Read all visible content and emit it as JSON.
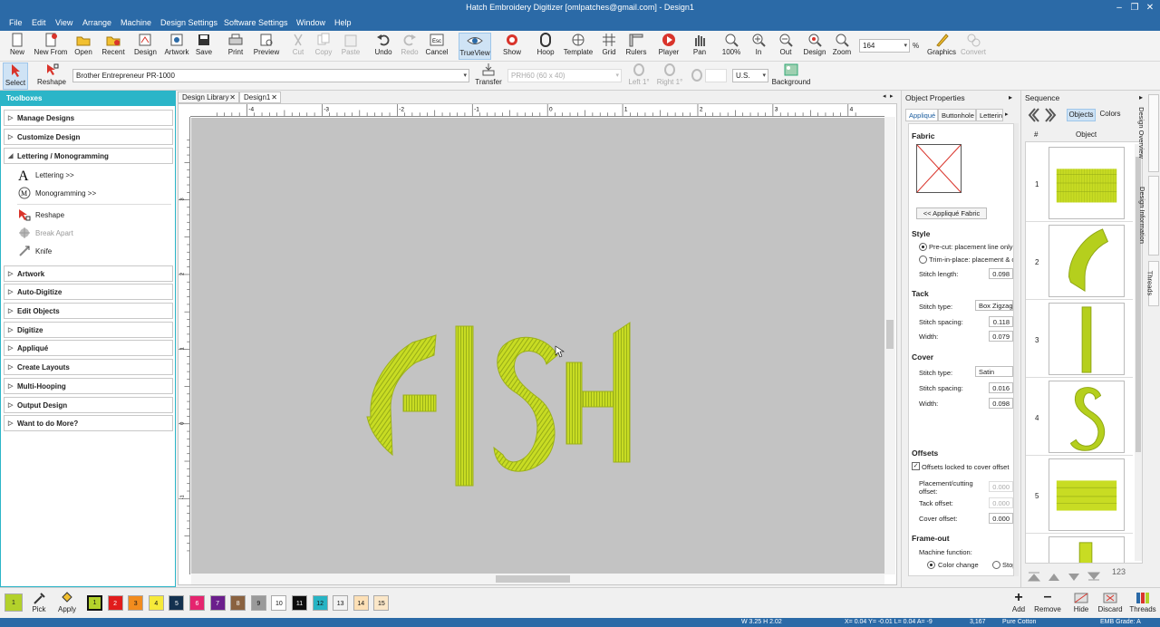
{
  "window": {
    "title": "Hatch Embroidery Digitizer [omlpatches@gmail.com] - Design1"
  },
  "menu": [
    "File",
    "Edit",
    "View",
    "Arrange",
    "Machine",
    "Design Settings",
    "Software Settings",
    "Window",
    "Help"
  ],
  "toolbar": {
    "items": [
      {
        "label": "New",
        "icon": "new-icon"
      },
      {
        "label": "New From",
        "icon": "new-from-icon"
      },
      {
        "label": "Open",
        "icon": "open-icon"
      },
      {
        "label": "Recent",
        "icon": "recent-icon"
      },
      {
        "label": "Design",
        "icon": "design-icon"
      },
      {
        "label": "Artwork",
        "icon": "artwork-icon"
      },
      {
        "label": "Save",
        "icon": "save-icon"
      },
      {
        "label": "Print",
        "icon": "print-icon"
      },
      {
        "label": "Preview",
        "icon": "preview-icon"
      },
      {
        "label": "Cut",
        "icon": "cut-icon"
      },
      {
        "label": "Copy",
        "icon": "copy-icon"
      },
      {
        "label": "Paste",
        "icon": "paste-icon"
      },
      {
        "label": "Undo",
        "icon": "undo-icon"
      },
      {
        "label": "Redo",
        "icon": "redo-icon"
      },
      {
        "label": "Cancel",
        "icon": "cancel-icon"
      },
      {
        "label": "TrueView",
        "icon": "trueview-icon"
      },
      {
        "label": "Show",
        "icon": "show-icon"
      },
      {
        "label": "Hoop",
        "icon": "hoop-icon"
      },
      {
        "label": "Template",
        "icon": "template-icon"
      },
      {
        "label": "Grid",
        "icon": "grid-icon"
      },
      {
        "label": "Rulers",
        "icon": "rulers-icon"
      },
      {
        "label": "Player",
        "icon": "player-icon"
      },
      {
        "label": "Pan",
        "icon": "pan-icon"
      },
      {
        "label": "100%",
        "icon": "zoom-100-icon"
      },
      {
        "label": "In",
        "icon": "zoom-in-icon"
      },
      {
        "label": "Out",
        "icon": "zoom-out-icon"
      },
      {
        "label": "Design",
        "icon": "zoom-design-icon"
      },
      {
        "label": "Zoom",
        "icon": "zoom-icon"
      },
      {
        "label": "Graphics",
        "icon": "graphics-icon"
      },
      {
        "label": "Convert",
        "icon": "convert-icon"
      }
    ],
    "cancel_key": "Esc",
    "zoom_value": "164",
    "zoom_unit": "%"
  },
  "toolbar2": {
    "select": "Select",
    "reshape": "Reshape",
    "machine": "Brother Entrepreneur PR-1000",
    "transfer": "Transfer",
    "hoop": "PRH60 (60 x 40)",
    "left": "Left 1°",
    "right": "Right 1°",
    "units": "U.S.",
    "background": "Background"
  },
  "toolboxes": {
    "title": "Toolboxes",
    "groups": [
      "Manage Designs",
      "Customize Design",
      "Lettering / Monogramming",
      "Artwork",
      "Auto-Digitize",
      "Edit Objects",
      "Digitize",
      "Appliqué",
      "Create Layouts",
      "Multi-Hooping",
      "Output Design",
      "Want to do More?"
    ],
    "lettering_items": [
      "Lettering >>",
      "Monogramming >>",
      "Reshape",
      "Break Apart",
      "Knife"
    ]
  },
  "tabs": {
    "library": "Design Library",
    "design": "Design1"
  },
  "rulers": {
    "h": [
      "-4",
      "-3",
      "-2",
      "-1",
      "0",
      "1",
      "2",
      "3",
      "4"
    ],
    "v": [
      "3",
      "2",
      "1",
      "0",
      "-1"
    ]
  },
  "design_text": "FISH",
  "object_properties": {
    "title": "Object Properties",
    "tabs": [
      "Appliqué",
      "Buttonhole",
      "Lettering"
    ],
    "fabric": "Fabric",
    "applique_fabric": "<< Appliqué Fabric",
    "style": "Style",
    "precut": "Pre-cut: placement line only",
    "trim": "Trim-in-place: placement & c...",
    "stitch_length_label": "Stitch length:",
    "stitch_length": "0.098",
    "tack": "Tack",
    "tack_type_label": "Stitch type:",
    "tack_type": "Box Zigzag",
    "tack_spacing_label": "Stitch spacing:",
    "tack_spacing": "0.118",
    "tack_width_label": "Width:",
    "tack_width": "0.079",
    "cover": "Cover",
    "cover_type_label": "Stitch type:",
    "cover_type": "Satin",
    "cover_spacing_label": "Stitch spacing:",
    "cover_spacing": "0.016",
    "cover_width_label": "Width:",
    "cover_width": "0.098",
    "offsets": "Offsets",
    "locked": "Offsets locked to cover offset",
    "placement_label": "Placement/cutting offset:",
    "placement": "0.000",
    "tack_offset_label": "Tack offset:",
    "tack_offset": "0.000",
    "cover_offset_label": "Cover offset:",
    "cover_offset": "0.000",
    "frameout": "Frame-out",
    "machine_function": "Machine function:",
    "color_change": "Color change",
    "stop": "Stop"
  },
  "sequence": {
    "title": "Sequence",
    "objects_tab": "Objects",
    "colors_tab": "Colors",
    "col_num": "#",
    "col_obj": "Object",
    "rows": [
      "1",
      "2",
      "3",
      "4",
      "5"
    ],
    "counter": "123"
  },
  "sidetabs": [
    "Design Overview",
    "Design Information",
    "Threads"
  ],
  "colorbar": {
    "current": "1",
    "pick": "Pick",
    "apply": "Apply",
    "swatches": [
      {
        "n": "1",
        "c": "#b3d12b"
      },
      {
        "n": "2",
        "c": "#e11c1c"
      },
      {
        "n": "3",
        "c": "#f28c1e"
      },
      {
        "n": "4",
        "c": "#f6ea3a"
      },
      {
        "n": "5",
        "c": "#13314f"
      },
      {
        "n": "6",
        "c": "#e5246e"
      },
      {
        "n": "7",
        "c": "#6b1e8c"
      },
      {
        "n": "8",
        "c": "#8a6240"
      },
      {
        "n": "9",
        "c": "#9a9a9a"
      },
      {
        "n": "10",
        "c": "#ffffff"
      },
      {
        "n": "11",
        "c": "#0d0d0d"
      },
      {
        "n": "12",
        "c": "#27b4c4"
      },
      {
        "n": "13",
        "c": "#f2f2f2"
      },
      {
        "n": "14",
        "c": "#fde0b6"
      },
      {
        "n": "15",
        "c": "#fbe7c8"
      }
    ],
    "add": "Add",
    "remove": "Remove",
    "hide": "Hide",
    "discard": "Discard",
    "threads": "Threads"
  },
  "status": {
    "size": "W 3.25 H 2.02",
    "coords": "X= 0.04 Y= -0.01 L= 0.04 A= -9",
    "count": "3,167",
    "fabric": "Pure Cotton",
    "grade": "EMB Grade: A"
  },
  "colors": {
    "accent": "#2b6aa7",
    "toolbox": "#2bb5c8",
    "thread": "#c8dc23"
  }
}
